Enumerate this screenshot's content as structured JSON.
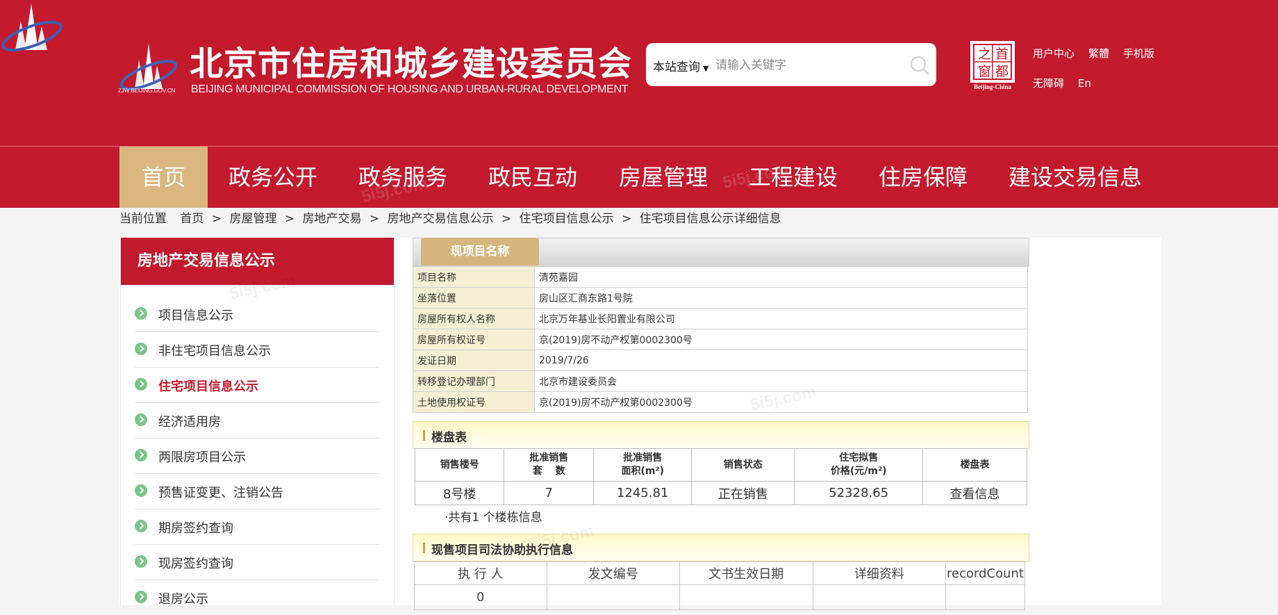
{
  "colors": {
    "brand_red": "#c31a2e",
    "nav_active_gold": "#d9b77e",
    "label_bg": "#f6efd3"
  },
  "header": {
    "logo_caption": "ZJW.BEIJING.GOV.CN",
    "title": "北京市住房和城乡建设委员会",
    "subtitle": "BEIJING MUNICIPAL COMMISSION OF HOUSING AND URBAN-RURAL DEVELOPMENT",
    "search": {
      "scope": "本站查询",
      "placeholder": "请输入关键字",
      "icon": "search-icon"
    },
    "capital_seal": {
      "chars": [
        "之",
        "首",
        "窗",
        "都"
      ],
      "caption": "Beijing-China"
    },
    "links_row1": [
      "用户中心",
      "繁體",
      "手机版"
    ],
    "links_row2": [
      "无障碍",
      "En"
    ]
  },
  "nav": {
    "items": [
      "首页",
      "政务公开",
      "政务服务",
      "政民互动",
      "房屋管理",
      "工程建设",
      "住房保障",
      "建设交易信息"
    ],
    "active": "首页"
  },
  "breadcrumb": {
    "prefix": "当前位置",
    "items": [
      "首页",
      "房屋管理",
      "房地产交易",
      "房地产交易信息公示",
      "住宅项目信息公示",
      "住宅项目信息公示详细信息"
    ],
    "separator": ">"
  },
  "sidebar": {
    "title": "房地产交易信息公示",
    "items": [
      "项目信息公示",
      "非住宅项目信息公示",
      "住宅项目信息公示",
      "经济适用房",
      "两限房项目公示",
      "预售证变更、注销公告",
      "期房签约查询",
      "现房签约查询",
      "退房公示"
    ],
    "active": "住宅项目信息公示"
  },
  "main": {
    "tab": "现项目名称",
    "info": [
      {
        "label": "项目名称",
        "value": "清苑嘉园"
      },
      {
        "label": "坐落位置",
        "value": "房山区汇商东路1号院"
      },
      {
        "label": "房屋所有权人名称",
        "value": "北京万年基业长阳置业有限公司"
      },
      {
        "label": "房屋所有权证号",
        "value": "京(2019)房不动产权第0002300号"
      },
      {
        "label": "发证日期",
        "value": "2019/7/26"
      },
      {
        "label": "转移登记办理部门",
        "value": "北京市建设委员会"
      },
      {
        "label": "土地使用权证号",
        "value": "京(2019)房不动产权第0002300号"
      }
    ],
    "buildings": {
      "title": "楼盘表",
      "headers": [
        "销售楼号",
        "批准销售\n套　 数",
        "批准销售\n面积(m²)",
        "销售状态",
        "住宅拟售\n价格(元/m²)",
        "楼盘表"
      ],
      "rows": [
        [
          "8号楼",
          "7",
          "1245.81",
          "正在销售",
          "52328.65",
          "查看信息"
        ]
      ],
      "count_note": "·共有1 个楼栋信息"
    },
    "judicial": {
      "title": "现售项目司法协助执行信息",
      "headers": [
        "执 行 人",
        "发文编号",
        "文书生效日期",
        "详细资料",
        "recordCount"
      ],
      "rows": [
        [
          "0",
          "",
          "",
          "",
          ""
        ]
      ]
    }
  }
}
